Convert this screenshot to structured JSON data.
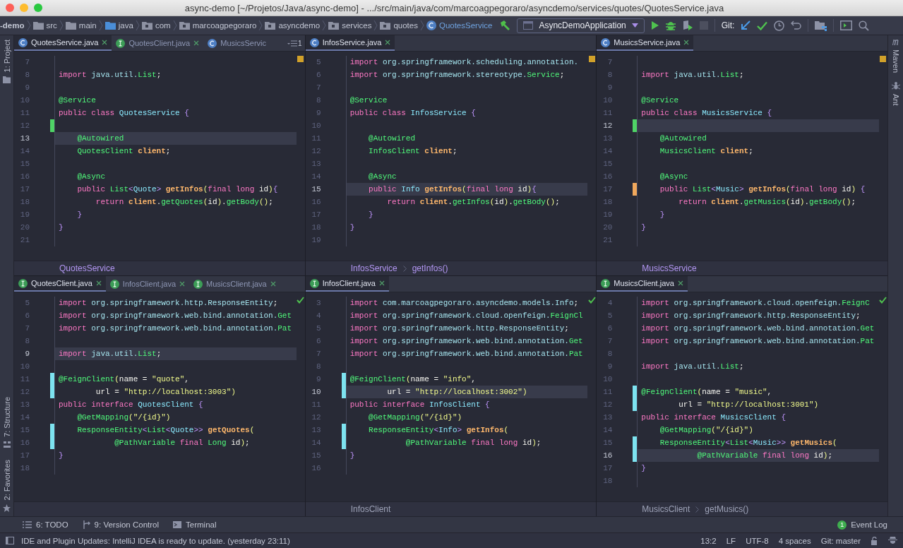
{
  "window": {
    "title": "async-demo [~/Projetos/Java/async-demo] - .../src/main/java/com/marcoagpegoraro/asyncdemo/services/quotes/QuotesService.java"
  },
  "navbar": {
    "path": [
      {
        "label": "-demo",
        "kind": "module"
      },
      {
        "label": "src",
        "kind": "folder"
      },
      {
        "label": "main",
        "kind": "folder"
      },
      {
        "label": "java",
        "kind": "source"
      },
      {
        "label": "com",
        "kind": "package"
      },
      {
        "label": "marcoagpegoraro",
        "kind": "package"
      },
      {
        "label": "asyncdemo",
        "kind": "package"
      },
      {
        "label": "services",
        "kind": "package"
      },
      {
        "label": "quotes",
        "kind": "package"
      },
      {
        "label": "QuotesService",
        "kind": "class"
      }
    ],
    "run_config": "AsyncDemoApplication",
    "git_label": "Git:"
  },
  "left_strip": [
    {
      "label": "1: Project",
      "kind": "project"
    },
    {
      "label": "7: Structure",
      "kind": "structure"
    },
    {
      "label": "2: Favorites",
      "kind": "favorites"
    }
  ],
  "right_strip": [
    {
      "label": "Maven",
      "kind": "maven"
    },
    {
      "label": "Ant",
      "kind": "ant"
    }
  ],
  "panes": [
    {
      "tabs": [
        {
          "label": "QuotesService.java",
          "kind": "class",
          "selected": true
        },
        {
          "label": "QuotesClient.java",
          "kind": "interface",
          "selected": false
        },
        {
          "label": "MusicsServic",
          "kind": "class",
          "selected": false
        }
      ],
      "overflow": "1",
      "has_warnings": true,
      "lines": [
        {
          "n": "7",
          "current": false
        },
        {
          "n": "8",
          "current": false,
          "code": [
            {
              "kind": "kw",
              "text": "import "
            },
            {
              "kind": "pkg",
              "text": "java.util."
            },
            {
              "kind": "type",
              "text": "List"
            },
            {
              "kind": "p",
              "text": ";"
            }
          ]
        },
        {
          "n": "9",
          "current": false
        },
        {
          "n": "10",
          "current": false,
          "code": [
            {
              "kind": "ann",
              "text": "@Service"
            }
          ]
        },
        {
          "n": "11",
          "current": false,
          "code": [
            {
              "kind": "kw",
              "text": "public class "
            },
            {
              "kind": "cls",
              "text": "QuotesService "
            },
            {
              "kind": "br",
              "text": "{"
            }
          ]
        },
        {
          "n": "12",
          "current": false,
          "marker": {
            "kind": "added"
          }
        },
        {
          "n": "13",
          "current": true,
          "code": [
            {
              "kind": "ann",
              "text": "    @Autowired"
            }
          ]
        },
        {
          "n": "14",
          "current": false,
          "code": [
            {
              "kind": "type",
              "text": "    QuotesClient "
            },
            {
              "kind": "fld",
              "text": "client"
            },
            {
              "kind": "p",
              "text": ";"
            }
          ]
        },
        {
          "n": "15",
          "current": false
        },
        {
          "n": "16",
          "current": false,
          "code": [
            {
              "kind": "ann",
              "text": "    @Async"
            }
          ]
        },
        {
          "n": "17",
          "current": false,
          "code": [
            {
              "kind": "kw",
              "text": "    public "
            },
            {
              "kind": "type",
              "text": "List"
            },
            {
              "kind": "br",
              "text": "<"
            },
            {
              "kind": "cls",
              "text": "Quote"
            },
            {
              "kind": "br",
              "text": "> "
            },
            {
              "kind": "fn",
              "text": "getInfos"
            },
            {
              "kind": "par",
              "text": "("
            },
            {
              "kind": "kw",
              "text": "final long "
            },
            {
              "kind": "p",
              "text": "id"
            },
            {
              "kind": "par",
              "text": ")"
            },
            {
              "kind": "br",
              "text": "{"
            }
          ]
        },
        {
          "n": "18",
          "current": false,
          "code": [
            {
              "kind": "kw",
              "text": "        return "
            },
            {
              "kind": "fld",
              "text": "client"
            },
            {
              "kind": "p",
              "text": "."
            },
            {
              "kind": "call",
              "text": "getQuotes"
            },
            {
              "kind": "par",
              "text": "("
            },
            {
              "kind": "p",
              "text": "id"
            },
            {
              "kind": "par",
              "text": ")"
            },
            {
              "kind": "p",
              "text": "."
            },
            {
              "kind": "call",
              "text": "getBody"
            },
            {
              "kind": "par",
              "text": "()"
            },
            {
              "kind": "p",
              "text": ";"
            }
          ]
        },
        {
          "n": "19",
          "current": false,
          "code": [
            {
              "kind": "br",
              "text": "    }"
            }
          ]
        },
        {
          "n": "20",
          "current": false,
          "code": [
            {
              "kind": "br",
              "text": "}"
            }
          ]
        },
        {
          "n": "21",
          "current": false
        }
      ],
      "breadcrumb": [
        {
          "label": "QuotesService",
          "active": true
        }
      ]
    },
    {
      "tabs": [
        {
          "label": "InfosService.java",
          "kind": "class",
          "selected": true
        }
      ],
      "has_warnings": true,
      "lines": [
        {
          "n": "5",
          "current": false,
          "code": [
            {
              "kind": "kw",
              "text": "import "
            },
            {
              "kind": "pkg",
              "text": "org.springframework.scheduling.annotation."
            }
          ]
        },
        {
          "n": "6",
          "current": false,
          "code": [
            {
              "kind": "kw",
              "text": "import "
            },
            {
              "kind": "pkg",
              "text": "org.springframework.stereotype."
            },
            {
              "kind": "type",
              "text": "Service"
            },
            {
              "kind": "p",
              "text": ";"
            }
          ]
        },
        {
          "n": "7",
          "current": false
        },
        {
          "n": "8",
          "current": false,
          "code": [
            {
              "kind": "ann",
              "text": "@Service"
            }
          ]
        },
        {
          "n": "9",
          "current": false,
          "code": [
            {
              "kind": "kw",
              "text": "public class "
            },
            {
              "kind": "cls",
              "text": "InfosService "
            },
            {
              "kind": "br",
              "text": "{"
            }
          ]
        },
        {
          "n": "10",
          "current": false
        },
        {
          "n": "11",
          "current": false,
          "code": [
            {
              "kind": "ann",
              "text": "    @Autowired"
            }
          ]
        },
        {
          "n": "12",
          "current": false,
          "code": [
            {
              "kind": "type",
              "text": "    InfosClient "
            },
            {
              "kind": "fld",
              "text": "client"
            },
            {
              "kind": "p",
              "text": ";"
            }
          ]
        },
        {
          "n": "13",
          "current": false
        },
        {
          "n": "14",
          "current": false,
          "code": [
            {
              "kind": "ann",
              "text": "    @Async"
            }
          ]
        },
        {
          "n": "15",
          "current": true,
          "code": [
            {
              "kind": "kw",
              "text": "    public "
            },
            {
              "kind": "cls",
              "text": "Info "
            },
            {
              "kind": "fn",
              "text": "getInfos"
            },
            {
              "kind": "par",
              "text": "("
            },
            {
              "kind": "kw",
              "text": "final long "
            },
            {
              "kind": "p",
              "text": "id"
            },
            {
              "kind": "par",
              "text": ")"
            },
            {
              "kind": "br",
              "text": "{"
            }
          ]
        },
        {
          "n": "16",
          "current": false,
          "code": [
            {
              "kind": "kw",
              "text": "        return "
            },
            {
              "kind": "fld",
              "text": "client"
            },
            {
              "kind": "p",
              "text": "."
            },
            {
              "kind": "call",
              "text": "getInfos"
            },
            {
              "kind": "par",
              "text": "("
            },
            {
              "kind": "p",
              "text": "id"
            },
            {
              "kind": "par",
              "text": ")"
            },
            {
              "kind": "p",
              "text": "."
            },
            {
              "kind": "call",
              "text": "getBody"
            },
            {
              "kind": "par",
              "text": "()"
            },
            {
              "kind": "p",
              "text": ";"
            }
          ]
        },
        {
          "n": "17",
          "current": false,
          "code": [
            {
              "kind": "br",
              "text": "    }"
            }
          ]
        },
        {
          "n": "18",
          "current": false,
          "code": [
            {
              "kind": "br",
              "text": "}"
            }
          ]
        },
        {
          "n": "19",
          "current": false
        }
      ],
      "breadcrumb": [
        {
          "label": "InfosService",
          "active": true
        },
        {
          "label": "getInfos()",
          "active": true
        }
      ]
    },
    {
      "tabs": [
        {
          "label": "MusicsService.java",
          "kind": "class",
          "selected": true
        }
      ],
      "has_warnings": true,
      "lines": [
        {
          "n": "7",
          "current": false
        },
        {
          "n": "8",
          "current": false,
          "code": [
            {
              "kind": "kw",
              "text": "import "
            },
            {
              "kind": "pkg",
              "text": "java.util."
            },
            {
              "kind": "type",
              "text": "List"
            },
            {
              "kind": "p",
              "text": ";"
            }
          ]
        },
        {
          "n": "9",
          "current": false
        },
        {
          "n": "10",
          "current": false,
          "code": [
            {
              "kind": "ann",
              "text": "@Service"
            }
          ]
        },
        {
          "n": "11",
          "current": false,
          "code": [
            {
              "kind": "kw",
              "text": "public class "
            },
            {
              "kind": "cls",
              "text": "MusicsService "
            },
            {
              "kind": "br",
              "text": "{"
            }
          ]
        },
        {
          "n": "12",
          "current": true,
          "marker": {
            "kind": "added"
          }
        },
        {
          "n": "13",
          "current": false,
          "code": [
            {
              "kind": "ann",
              "text": "    @Autowired"
            }
          ]
        },
        {
          "n": "14",
          "current": false,
          "code": [
            {
              "kind": "type",
              "text": "    MusicsClient "
            },
            {
              "kind": "fld",
              "text": "client"
            },
            {
              "kind": "p",
              "text": ";"
            }
          ]
        },
        {
          "n": "15",
          "current": false
        },
        {
          "n": "16",
          "current": false,
          "code": [
            {
              "kind": "ann",
              "text": "    @Async"
            }
          ]
        },
        {
          "n": "17",
          "current": false,
          "marker": {
            "kind": "conflict"
          },
          "code": [
            {
              "kind": "kw",
              "text": "    public "
            },
            {
              "kind": "type",
              "text": "List"
            },
            {
              "kind": "br",
              "text": "<"
            },
            {
              "kind": "cls",
              "text": "Music"
            },
            {
              "kind": "br",
              "text": "> "
            },
            {
              "kind": "fn",
              "text": "getInfos"
            },
            {
              "kind": "par",
              "text": "("
            },
            {
              "kind": "kw",
              "text": "final long "
            },
            {
              "kind": "p",
              "text": "id"
            },
            {
              "kind": "par",
              "text": ") "
            },
            {
              "kind": "br",
              "text": "{"
            }
          ]
        },
        {
          "n": "18",
          "current": false,
          "code": [
            {
              "kind": "kw",
              "text": "        return "
            },
            {
              "kind": "fld",
              "text": "client"
            },
            {
              "kind": "p",
              "text": "."
            },
            {
              "kind": "call",
              "text": "getMusics"
            },
            {
              "kind": "par",
              "text": "("
            },
            {
              "kind": "p",
              "text": "id"
            },
            {
              "kind": "par",
              "text": ")"
            },
            {
              "kind": "p",
              "text": "."
            },
            {
              "kind": "call",
              "text": "getBody"
            },
            {
              "kind": "par",
              "text": "()"
            },
            {
              "kind": "p",
              "text": ";"
            }
          ]
        },
        {
          "n": "19",
          "current": false,
          "code": [
            {
              "kind": "br",
              "text": "    }"
            }
          ]
        },
        {
          "n": "20",
          "current": false,
          "code": [
            {
              "kind": "br",
              "text": "}"
            }
          ]
        },
        {
          "n": "21",
          "current": false
        }
      ],
      "breadcrumb": [
        {
          "label": "MusicsService",
          "active": true
        }
      ]
    },
    {
      "tabs": [
        {
          "label": "QuotesClient.java",
          "kind": "interface",
          "selected": true
        },
        {
          "label": "InfosClient.java",
          "kind": "interface",
          "selected": false
        },
        {
          "label": "MusicsClient.java",
          "kind": "interface",
          "selected": false
        }
      ],
      "has_warnings": false,
      "lines": [
        {
          "n": "5",
          "current": false,
          "code": [
            {
              "kind": "kw",
              "text": "import "
            },
            {
              "kind": "pkg",
              "text": "org.springframework.http.ResponseEntity"
            },
            {
              "kind": "p",
              "text": ";"
            }
          ]
        },
        {
          "n": "6",
          "current": false,
          "code": [
            {
              "kind": "kw",
              "text": "import "
            },
            {
              "kind": "pkg",
              "text": "org.springframework.web.bind.annotation."
            },
            {
              "kind": "type",
              "text": "Get"
            }
          ]
        },
        {
          "n": "7",
          "current": false,
          "code": [
            {
              "kind": "kw",
              "text": "import "
            },
            {
              "kind": "pkg",
              "text": "org.springframework.web.bind.annotation."
            },
            {
              "kind": "type",
              "text": "Pat"
            }
          ]
        },
        {
          "n": "8",
          "current": false
        },
        {
          "n": "9",
          "current": true,
          "code": [
            {
              "kind": "kw",
              "text": "import "
            },
            {
              "kind": "pkg",
              "text": "java.util."
            },
            {
              "kind": "type",
              "text": "List"
            },
            {
              "kind": "p",
              "text": ";"
            }
          ]
        },
        {
          "n": "10",
          "current": false
        },
        {
          "n": "11",
          "current": false,
          "marker": {
            "kind": "modified"
          },
          "code": [
            {
              "kind": "ann",
              "text": "@FeignClient"
            },
            {
              "kind": "par",
              "text": "("
            },
            {
              "kind": "p",
              "text": "name = "
            },
            {
              "kind": "str",
              "text": "\"quote\""
            },
            {
              "kind": "p",
              "text": ","
            }
          ]
        },
        {
          "n": "12",
          "current": false,
          "marker": {
            "kind": "modified"
          },
          "code": [
            {
              "kind": "p",
              "text": "        url = "
            },
            {
              "kind": "str",
              "text": "\"http://localhost:3003\""
            },
            {
              "kind": "par",
              "text": ")"
            }
          ]
        },
        {
          "n": "13",
          "current": false,
          "code": [
            {
              "kind": "kw",
              "text": "public interface "
            },
            {
              "kind": "cls",
              "text": "QuotesClient "
            },
            {
              "kind": "br",
              "text": "{"
            }
          ]
        },
        {
          "n": "14",
          "current": false,
          "code": [
            {
              "kind": "ann",
              "text": "    @GetMapping"
            },
            {
              "kind": "par",
              "text": "("
            },
            {
              "kind": "str",
              "text": "\"/{id}\""
            },
            {
              "kind": "par",
              "text": ")"
            }
          ]
        },
        {
          "n": "15",
          "current": false,
          "marker": {
            "kind": "modified"
          },
          "code": [
            {
              "kind": "type",
              "text": "    ResponseEntity"
            },
            {
              "kind": "br",
              "text": "<"
            },
            {
              "kind": "type",
              "text": "List"
            },
            {
              "kind": "br",
              "text": "<"
            },
            {
              "kind": "cls",
              "text": "Quote"
            },
            {
              "kind": "br",
              "text": ">> "
            },
            {
              "kind": "fn",
              "text": "getQuotes"
            },
            {
              "kind": "par",
              "text": "("
            }
          ]
        },
        {
          "n": "16",
          "current": false,
          "marker": {
            "kind": "modified"
          },
          "code": [
            {
              "kind": "ann",
              "text": "            @PathVariable "
            },
            {
              "kind": "kw",
              "text": "final "
            },
            {
              "kind": "type",
              "text": "Long "
            },
            {
              "kind": "p",
              "text": "id"
            },
            {
              "kind": "par",
              "text": ")"
            },
            {
              "kind": "p",
              "text": ";"
            }
          ]
        },
        {
          "n": "17",
          "current": false,
          "code": [
            {
              "kind": "br",
              "text": "}"
            }
          ]
        },
        {
          "n": "18",
          "current": false
        }
      ]
    },
    {
      "tabs": [
        {
          "label": "InfosClient.java",
          "kind": "interface",
          "selected": true
        }
      ],
      "has_warnings": false,
      "lines": [
        {
          "n": "3",
          "current": false,
          "code": [
            {
              "kind": "kw",
              "text": "import "
            },
            {
              "kind": "pkg",
              "text": "com.marcoagpegoraro.asyncdemo.models.Info"
            },
            {
              "kind": "p",
              "text": ";"
            }
          ]
        },
        {
          "n": "4",
          "current": false,
          "code": [
            {
              "kind": "kw",
              "text": "import "
            },
            {
              "kind": "pkg",
              "text": "org.springframework.cloud.openfeign."
            },
            {
              "kind": "type",
              "text": "FeignCl"
            }
          ]
        },
        {
          "n": "5",
          "current": false,
          "code": [
            {
              "kind": "kw",
              "text": "import "
            },
            {
              "kind": "pkg",
              "text": "org.springframework.http.ResponseEntity"
            },
            {
              "kind": "p",
              "text": ";"
            }
          ]
        },
        {
          "n": "6",
          "current": false,
          "code": [
            {
              "kind": "kw",
              "text": "import "
            },
            {
              "kind": "pkg",
              "text": "org.springframework.web.bind.annotation."
            },
            {
              "kind": "type",
              "text": "Get"
            }
          ]
        },
        {
          "n": "7",
          "current": false,
          "code": [
            {
              "kind": "kw",
              "text": "import "
            },
            {
              "kind": "pkg",
              "text": "org.springframework.web.bind.annotation."
            },
            {
              "kind": "type",
              "text": "Pat"
            }
          ]
        },
        {
          "n": "8",
          "current": false
        },
        {
          "n": "9",
          "current": false,
          "marker": {
            "kind": "modified"
          },
          "code": [
            {
              "kind": "ann",
              "text": "@FeignClient"
            },
            {
              "kind": "par",
              "text": "("
            },
            {
              "kind": "p",
              "text": "name = "
            },
            {
              "kind": "str",
              "text": "\"info\""
            },
            {
              "kind": "p",
              "text": ","
            }
          ]
        },
        {
          "n": "10",
          "current": true,
          "marker": {
            "kind": "modified"
          },
          "code": [
            {
              "kind": "p",
              "text": "        url = "
            },
            {
              "kind": "str",
              "text": "\"http://localhost:3002\""
            },
            {
              "kind": "par",
              "text": ")"
            }
          ]
        },
        {
          "n": "11",
          "current": false,
          "code": [
            {
              "kind": "kw",
              "text": "public interface "
            },
            {
              "kind": "cls",
              "text": "InfosClient "
            },
            {
              "kind": "br",
              "text": "{"
            }
          ]
        },
        {
          "n": "12",
          "current": false,
          "code": [
            {
              "kind": "ann",
              "text": "    @GetMapping"
            },
            {
              "kind": "par",
              "text": "("
            },
            {
              "kind": "str",
              "text": "\"/{id}\""
            },
            {
              "kind": "par",
              "text": ")"
            }
          ]
        },
        {
          "n": "13",
          "current": false,
          "marker": {
            "kind": "modified"
          },
          "code": [
            {
              "kind": "type",
              "text": "    ResponseEntity"
            },
            {
              "kind": "br",
              "text": "<"
            },
            {
              "kind": "cls",
              "text": "Info"
            },
            {
              "kind": "br",
              "text": "> "
            },
            {
              "kind": "fn",
              "text": "getInfos"
            },
            {
              "kind": "par",
              "text": "("
            }
          ]
        },
        {
          "n": "14",
          "current": false,
          "marker": {
            "kind": "modified"
          },
          "code": [
            {
              "kind": "ann",
              "text": "            @PathVariable "
            },
            {
              "kind": "kw",
              "text": "final long "
            },
            {
              "kind": "p",
              "text": "id"
            },
            {
              "kind": "par",
              "text": ")"
            },
            {
              "kind": "p",
              "text": ";"
            }
          ]
        },
        {
          "n": "15",
          "current": false,
          "code": [
            {
              "kind": "br",
              "text": "}"
            }
          ]
        },
        {
          "n": "16",
          "current": false
        }
      ],
      "breadcrumb": [
        {
          "label": "InfosClient",
          "active": false
        }
      ]
    },
    {
      "tabs": [
        {
          "label": "MusicsClient.java",
          "kind": "interface",
          "selected": true
        }
      ],
      "has_warnings": false,
      "lines": [
        {
          "n": "4",
          "current": false,
          "code": [
            {
              "kind": "kw",
              "text": "import "
            },
            {
              "kind": "pkg",
              "text": "org.springframework.cloud.openfeign."
            },
            {
              "kind": "type",
              "text": "FeignC"
            }
          ]
        },
        {
          "n": "5",
          "current": false,
          "code": [
            {
              "kind": "kw",
              "text": "import "
            },
            {
              "kind": "pkg",
              "text": "org.springframework.http.ResponseEntity"
            },
            {
              "kind": "p",
              "text": ";"
            }
          ]
        },
        {
          "n": "6",
          "current": false,
          "code": [
            {
              "kind": "kw",
              "text": "import "
            },
            {
              "kind": "pkg",
              "text": "org.springframework.web.bind.annotation."
            },
            {
              "kind": "type",
              "text": "Get"
            }
          ]
        },
        {
          "n": "7",
          "current": false,
          "code": [
            {
              "kind": "kw",
              "text": "import "
            },
            {
              "kind": "pkg",
              "text": "org.springframework.web.bind.annotation."
            },
            {
              "kind": "type",
              "text": "Pat"
            }
          ]
        },
        {
          "n": "8",
          "current": false
        },
        {
          "n": "9",
          "current": false,
          "code": [
            {
              "kind": "kw",
              "text": "import "
            },
            {
              "kind": "pkg",
              "text": "java.util."
            },
            {
              "kind": "type",
              "text": "List"
            },
            {
              "kind": "p",
              "text": ";"
            }
          ]
        },
        {
          "n": "10",
          "current": false
        },
        {
          "n": "11",
          "current": false,
          "marker": {
            "kind": "modified"
          },
          "code": [
            {
              "kind": "ann",
              "text": "@FeignClient"
            },
            {
              "kind": "par",
              "text": "("
            },
            {
              "kind": "p",
              "text": "name = "
            },
            {
              "kind": "str",
              "text": "\"music\""
            },
            {
              "kind": "p",
              "text": ","
            }
          ]
        },
        {
          "n": "12",
          "current": false,
          "marker": {
            "kind": "modified"
          },
          "code": [
            {
              "kind": "p",
              "text": "        url = "
            },
            {
              "kind": "str",
              "text": "\"http://localhost:3001\""
            },
            {
              "kind": "par",
              "text": ")"
            }
          ]
        },
        {
          "n": "13",
          "current": false,
          "code": [
            {
              "kind": "kw",
              "text": "public interface "
            },
            {
              "kind": "cls",
              "text": "MusicsClient "
            },
            {
              "kind": "br",
              "text": "{"
            }
          ]
        },
        {
          "n": "14",
          "current": false,
          "code": [
            {
              "kind": "ann",
              "text": "    @GetMapping"
            },
            {
              "kind": "par",
              "text": "("
            },
            {
              "kind": "str",
              "text": "\"/{id}\""
            },
            {
              "kind": "par",
              "text": ")"
            }
          ]
        },
        {
          "n": "15",
          "current": false,
          "marker": {
            "kind": "modified"
          },
          "code": [
            {
              "kind": "type",
              "text": "    ResponseEntity"
            },
            {
              "kind": "br",
              "text": "<"
            },
            {
              "kind": "type",
              "text": "List"
            },
            {
              "kind": "br",
              "text": "<"
            },
            {
              "kind": "cls",
              "text": "Music"
            },
            {
              "kind": "br",
              "text": ">> "
            },
            {
              "kind": "fn",
              "text": "getMusics"
            },
            {
              "kind": "par",
              "text": "("
            }
          ]
        },
        {
          "n": "16",
          "current": true,
          "marker": {
            "kind": "modified"
          },
          "code": [
            {
              "kind": "ann",
              "text": "            @PathVariable "
            },
            {
              "kind": "kw",
              "text": "final long "
            },
            {
              "kind": "p",
              "text": "id"
            },
            {
              "kind": "par",
              "text": ")"
            },
            {
              "kind": "p",
              "text": ";"
            }
          ]
        },
        {
          "n": "17",
          "current": false,
          "code": [
            {
              "kind": "br",
              "text": "}"
            }
          ]
        },
        {
          "n": "18",
          "current": false
        }
      ],
      "breadcrumb": [
        {
          "label": "MusicsClient",
          "active": false
        },
        {
          "label": "getMusics()",
          "active": false
        }
      ]
    }
  ],
  "tool_windows": [
    {
      "label": "6: TODO",
      "kind": "todo"
    },
    {
      "label": "9: Version Control",
      "kind": "vcs"
    },
    {
      "label": "Terminal",
      "kind": "terminal"
    }
  ],
  "event_log": {
    "label": "Event Log",
    "count": "1"
  },
  "status_bar": {
    "message": "IDE and Plugin Updates: IntelliJ IDEA is ready to update. (yesterday 23:11)",
    "items": [
      "13:2",
      "LF",
      "UTF-8",
      "4 spaces",
      "Git: master"
    ]
  }
}
